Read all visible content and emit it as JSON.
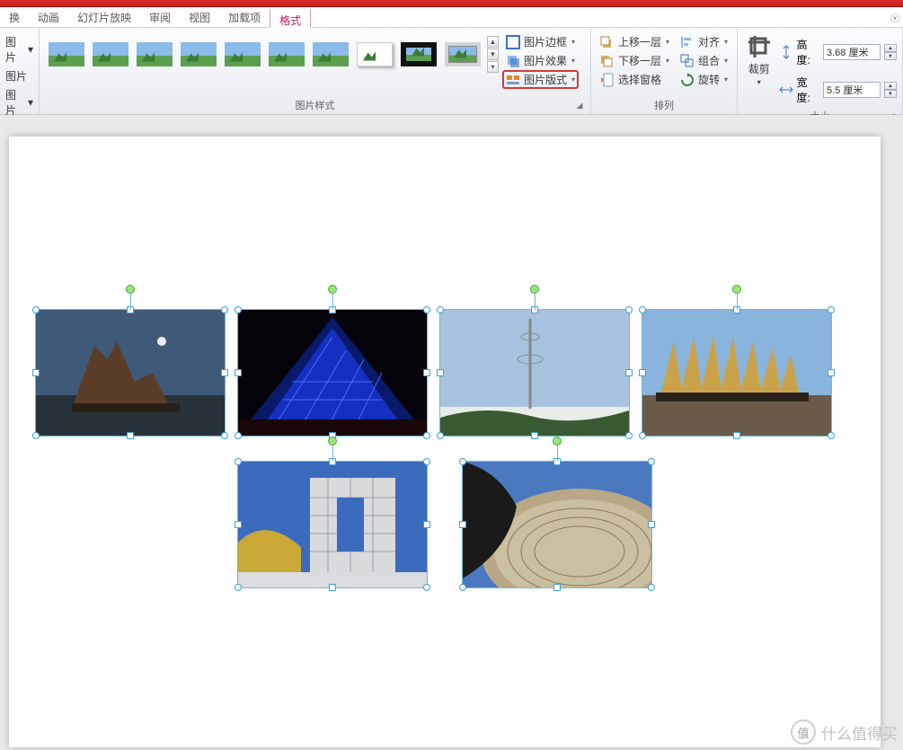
{
  "tabs": [
    "换",
    "动画",
    "幻灯片放映",
    "审阅",
    "视图",
    "加载项",
    "格式"
  ],
  "active_tab": 6,
  "adjust": {
    "items": [
      "图片",
      "图片",
      "图片"
    ],
    "drop": "▾"
  },
  "groups": {
    "styles_label": "图片样式",
    "arrange_label": "排列",
    "size_label": "大小"
  },
  "style_menu": {
    "border": "图片边框",
    "effects": "图片效果",
    "layout": "图片版式"
  },
  "arrange": {
    "bring": "上移一层",
    "send": "下移一层",
    "pane": "选择窗格",
    "align": "对齐",
    "group": "组合",
    "rotate": "旋转"
  },
  "crop": "裁剪",
  "size": {
    "height_label": "高度:",
    "height_val": "3.68 厘米",
    "width_label": "宽度:",
    "width_val": "5.5 厘米"
  },
  "watermark": {
    "icon": "值",
    "text": "什么值得买"
  }
}
